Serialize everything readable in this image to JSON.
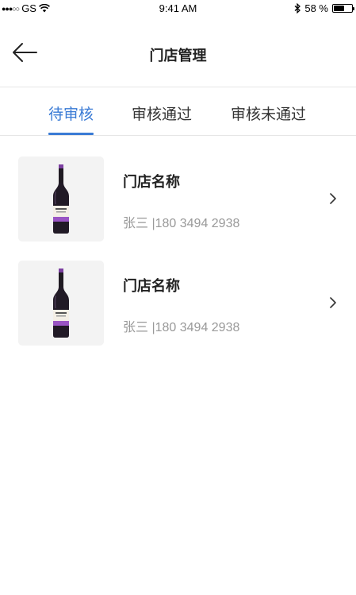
{
  "status_bar": {
    "carrier": "GS",
    "time": "9:41 AM",
    "battery": "58 %",
    "battery_level": 0.58
  },
  "header": {
    "title": "门店管理"
  },
  "tabs": [
    {
      "label": "待审核",
      "active": true
    },
    {
      "label": "审核通过",
      "active": false
    },
    {
      "label": "审核未通过",
      "active": false
    }
  ],
  "stores": [
    {
      "name": "门店名称",
      "contact": "张三 |180 3494 2938",
      "image_icon": "wine-bottle-icon"
    },
    {
      "name": "门店名称",
      "contact": "张三 |180 3494 2938",
      "image_icon": "wine-bottle-icon"
    }
  ],
  "colors": {
    "accent": "#3a7bd5",
    "secondary_text": "#999999",
    "thumb_bg": "#f3f3f3"
  }
}
